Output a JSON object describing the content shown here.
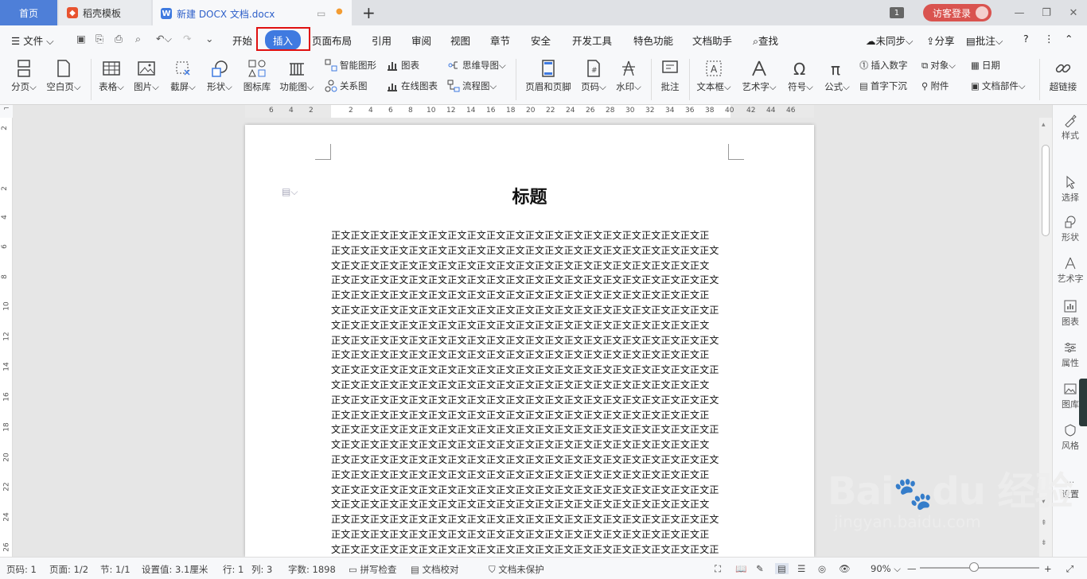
{
  "tabs": {
    "home": "首页",
    "daoke": "稻壳模板",
    "doc": "新建 DOCX 文档.docx",
    "badge": "1",
    "login": "访客登录"
  },
  "menu": {
    "file": "文件",
    "items": [
      "开始",
      "插入",
      "页面布局",
      "引用",
      "审阅",
      "视图",
      "章节",
      "安全",
      "开发工具",
      "特色功能",
      "文档助手"
    ],
    "active": "插入",
    "search": "查找",
    "sync": "未同步",
    "share": "分享",
    "comment": "批注"
  },
  "ribbon": {
    "pagebreak": "分页",
    "blankpage": "空白页",
    "table": "表格",
    "picture": "图片",
    "screenshot": "截屏",
    "shape": "形状",
    "iconlib": "图标库",
    "funcchart": "功能图",
    "smartart": "智能图形",
    "chart": "图表",
    "mindmap": "思维导图",
    "relation": "关系图",
    "onlinechart": "在线图表",
    "flowchart": "流程图",
    "headerfooter": "页眉和页脚",
    "pagenum": "页码",
    "watermark": "水印",
    "comment": "批注",
    "textbox": "文本框",
    "wordart": "艺术字",
    "symbol": "符号",
    "formula": "公式",
    "insertnum": "插入数字",
    "object": "对象",
    "date": "日期",
    "dropcap": "首字下沉",
    "attachment": "附件",
    "docpart": "文档部件",
    "hyperlink": "超链接"
  },
  "ruler_h": [
    "6",
    "4",
    "2",
    "2",
    "4",
    "6",
    "8",
    "10",
    "12",
    "14",
    "16",
    "18",
    "20",
    "22",
    "24",
    "26",
    "28",
    "30",
    "32",
    "34",
    "36",
    "38",
    "40",
    "42",
    "44",
    "46"
  ],
  "ruler_v": [
    "2",
    "2",
    "4",
    "6",
    "8",
    "10",
    "12",
    "14",
    "16",
    "18",
    "20",
    "22",
    "24",
    "26"
  ],
  "document": {
    "title": "标题",
    "lines": [
      "正文正文正文正文正文正文正文正文正文正文正文正文正文正文正文正文正文正文正文正",
      "正文正文正文正文正文正文正文正文正文正文正文正文正文正文正文正文正文正文正文正文",
      "文正文正文正文正文正文正文正文正文正文正文正文正文正文正文正文正文正文正文正文",
      "正文正文正文正文正文正文正文正文正文正文正文正文正文正文正文正文正文正文正文正文",
      "正文正文正文正文正文正文正文正文正文正文正文正文正文正文正文正文正文正文正文正",
      "文正文正文正文正文正文正文正文正文正文正文正文正文正文正文正文正文正文正文正文正",
      "文正文正文正文正文正文正文正文正文正文正文正文正文正文正文正文正文正文正文正文",
      "正文正文正文正文正文正文正文正文正文正文正文正文正文正文正文正文正文正文正文正文",
      "正文正文正文正文正文正文正文正文正文正文正文正文正文正文正文正文正文正文正文正",
      "文正文正文正文正文正文正文正文正文正文正文正文正文正文正文正文正文正文正文正文正",
      "文正文正文正文正文正文正文正文正文正文正文正文正文正文正文正文正文正文正文正文",
      "正文正文正文正文正文正文正文正文正文正文正文正文正文正文正文正文正文正文正文正文",
      "正文正文正文正文正文正文正文正文正文正文正文正文正文正文正文正文正文正文正文正",
      "文正文正文正文正文正文正文正文正文正文正文正文正文正文正文正文正文正文正文正文正",
      "文正文正文正文正文正文正文正文正文正文正文正文正文正文正文正文正文正文正文正文",
      "正文正文正文正文正文正文正文正文正文正文正文正文正文正文正文正文正文正文正文正文",
      "正文正文正文正文正文正文正文正文正文正文正文正文正文正文正文正文正文正文正文正",
      "文正文正文正文正文正文正文正文正文正文正文正文正文正文正文正文正文正文正文正文正",
      "文正文正文正文正文正文正文正文正文正文正文正文正文正文正文正文正文正文正文正文",
      "正文正文正文正文正文正文正文正文正文正文正文正文正文正文正文正文正文正文正文正文",
      "正文正文正文正文正文正文正文正文正文正文正文正文正文正文正文正文正文正文正文正",
      "文正文正文正文正文正文正文正文正文正文正文正文正文正文正文正文正文正文正文正文正"
    ]
  },
  "sidepanel": [
    "样式",
    "选择",
    "形状",
    "艺术字",
    "图表",
    "属性",
    "图库",
    "风格",
    "设置"
  ],
  "status": {
    "pagenum": "页码: 1",
    "pages": "页面: 1/2",
    "section": "节: 1/1",
    "setting": "设置值: 3.1厘米",
    "row": "行: 1",
    "col": "列: 3",
    "words": "字数: 1898",
    "spell": "拼写检查",
    "proof": "文档校对",
    "protect": "文档未保护",
    "zoom": "90%",
    "zoom_fraction": 0.9
  },
  "watermark": {
    "brand": "Bai du 经验",
    "url": "jingyan.baidu.com"
  },
  "colors": {
    "accent": "#3f7ae0",
    "highlight_box": "#e01010",
    "login": "#d9534f"
  }
}
